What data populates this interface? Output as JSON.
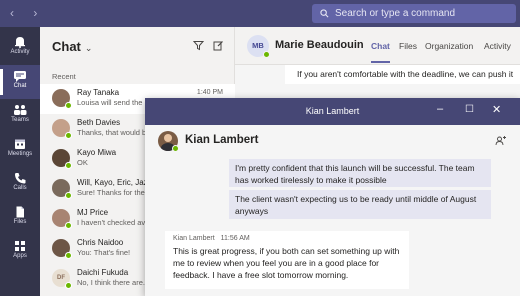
{
  "search": {
    "placeholder": "Search or type a command"
  },
  "rail": [
    {
      "label": "Activity",
      "icon": "bell-icon"
    },
    {
      "label": "Chat",
      "icon": "chat-icon"
    },
    {
      "label": "Teams",
      "icon": "teams-icon"
    },
    {
      "label": "Meetings",
      "icon": "calendar-icon"
    },
    {
      "label": "Calls",
      "icon": "phone-icon"
    },
    {
      "label": "Files",
      "icon": "file-icon"
    },
    {
      "label": "Apps",
      "icon": "apps-icon"
    }
  ],
  "chat_panel": {
    "title": "Chat",
    "section": "Recent",
    "contacts": [
      {
        "name": "Ray Tanaka",
        "preview": "Louisa will send the i...",
        "time": "1:40 PM",
        "avatar_color": "#8a6d5a"
      },
      {
        "name": "Beth Davies",
        "preview": "Thanks, that would be...",
        "time": "",
        "avatar_color": "#c4a08a"
      },
      {
        "name": "Kayo Miwa",
        "preview": "OK",
        "time": "",
        "avatar_color": "#5b4636"
      },
      {
        "name": "Will, Kayo, Eric, Jaz...",
        "preview": "Sure! Thanks for the...",
        "time": "",
        "avatar_color": "#7a6a5c"
      },
      {
        "name": "MJ Price",
        "preview": "I haven't checked ava...",
        "time": "",
        "avatar_color": "#a88472"
      },
      {
        "name": "Chris Naidoo",
        "preview": "You: That's fine!",
        "time": "",
        "avatar_color": "#6d5646"
      },
      {
        "name": "Daichi Fukuda",
        "preview": "No, I think there are...",
        "time": "",
        "avatar_initials": "DF",
        "avatar_color": "#e8dfd2"
      }
    ]
  },
  "conversation": {
    "initials": "MB",
    "name": "Marie Beaudouin",
    "tabs": [
      "Chat",
      "Files",
      "Organization",
      "Activity"
    ],
    "visible_message": "If you aren't comfortable with the deadline, we can push it"
  },
  "popout": {
    "window_title": "Kian Lambert",
    "contact_name": "Kian Lambert",
    "my_messages": [
      "I'm pretty confident that this launch will be successful. The team has worked tirelessly to make it possible",
      "The client wasn't expecting us to be ready until middle of August anyways"
    ],
    "reply": {
      "sender": "Kian Lambert",
      "time": "11:56 AM",
      "text": "This is great progress, if you both can set something up with me to review when you feel you are in a good place for feedback. I have a free slot tomorrow morning."
    }
  },
  "colors": {
    "brand": "#464775",
    "accent": "#6264a7",
    "rail": "#33344a",
    "presence_available": "#6bb700"
  }
}
